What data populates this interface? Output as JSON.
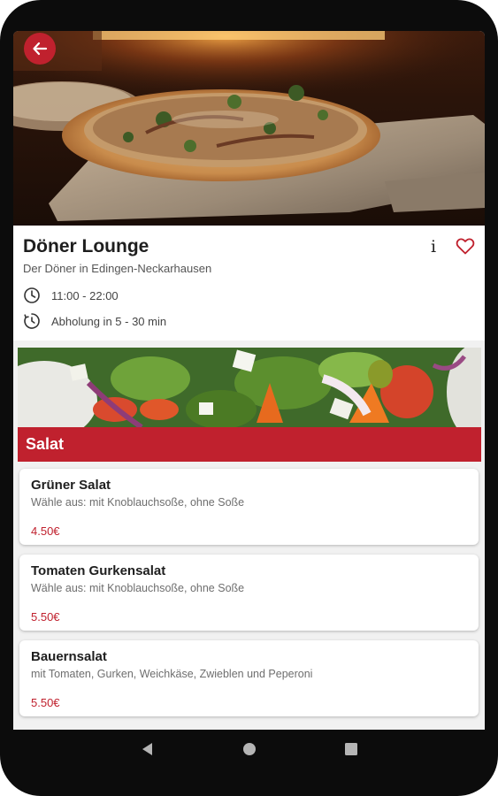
{
  "restaurant": {
    "name": "Döner Lounge",
    "subtitle": "Der Döner in Edingen-Neckarhausen",
    "opening_hours": "11:00 - 22:00",
    "pickup": "Abholung in 5 - 30 min",
    "info_symbol": "i"
  },
  "category": {
    "title": "Salat"
  },
  "items": [
    {
      "name": "Grüner Salat",
      "description": "Wähle aus: mit Knoblauchsoße, ohne Soße",
      "price": "4.50€"
    },
    {
      "name": "Tomaten Gurkensalat",
      "description": "Wähle aus: mit Knoblauchsoße, ohne Soße",
      "price": "5.50€"
    },
    {
      "name": "Bauernsalat",
      "description": "mit Tomaten, Gurken, Weichkäse, Zwieblen und Peperoni",
      "price": "5.50€"
    }
  ],
  "icons": {
    "back": "arrow-left-icon",
    "info": "info-icon",
    "favorite": "heart-outline-icon",
    "hours": "clock-icon",
    "pickup": "timer-icon",
    "nav_back": "triangle-back-icon",
    "nav_home": "circle-home-icon",
    "nav_recents": "square-recents-icon"
  },
  "colors": {
    "accent": "#c0212e",
    "device_frame": "#0c0c0c",
    "background": "#f1f1f1"
  }
}
